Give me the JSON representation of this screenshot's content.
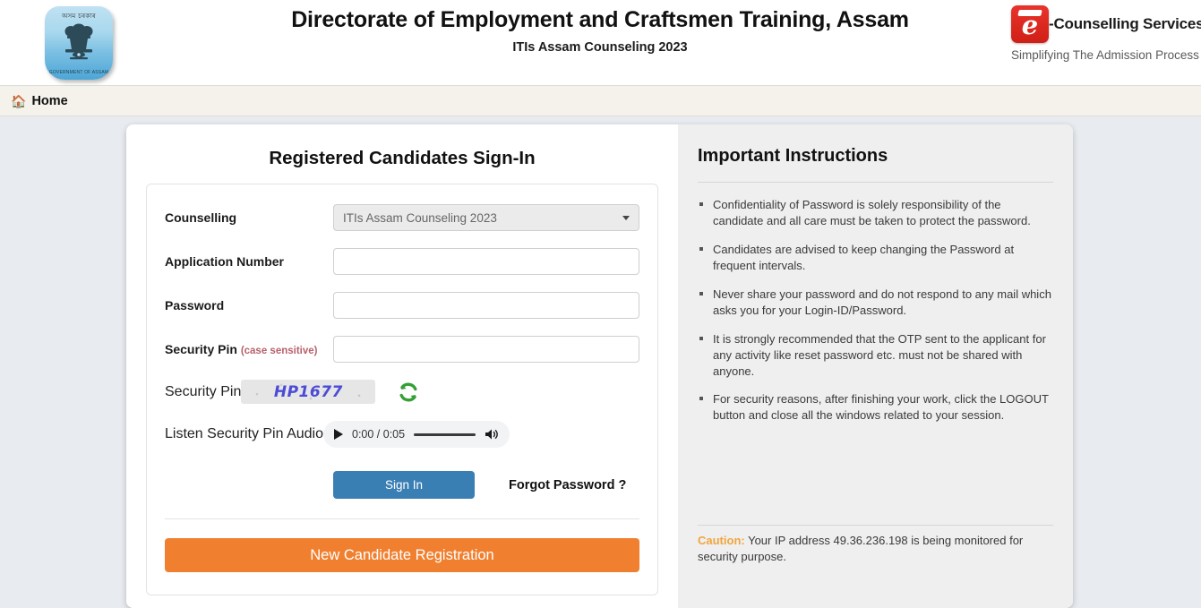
{
  "header": {
    "logo_left": {
      "top_script": "অসম চৰকাৰ",
      "bottom_script": "GOVERNMENT OF ASSAM"
    },
    "title": "Directorate of Employment and Craftsmen Training, Assam",
    "subtitle": "ITIs Assam Counseling 2023",
    "logo_right": {
      "badge_letter": "e",
      "name": "-Counselling Services",
      "tagline": "Simplifying The Admission Process"
    }
  },
  "navbar": {
    "home_label": "Home",
    "home_icon": "home-icon"
  },
  "signin": {
    "title": "Registered Candidates Sign-In",
    "fields": {
      "counselling_label": "Counselling",
      "counselling_value": "ITIs Assam Counseling 2023",
      "application_label": "Application Number",
      "application_value": "",
      "password_label": "Password",
      "password_value": "",
      "security_pin_label": "Security Pin",
      "security_pin_hint": "(case sensitive)",
      "security_pin_value": "",
      "captcha_label": "Security Pin",
      "captcha_text": "HP1677",
      "refresh_icon": "refresh-icon",
      "audio_label": "Listen Security Pin Audio",
      "audio_time": "0:00 / 0:05"
    },
    "signin_button": "Sign In",
    "forgot_password": "Forgot Password ?",
    "register_button": "New Candidate Registration"
  },
  "instructions": {
    "title": "Important Instructions",
    "items": [
      "Confidentiality of Password is solely responsibility of the candidate and all care must be taken to protect the password.",
      "Candidates are advised to keep changing the Password at frequent intervals.",
      "Never share your password and do not respond to any mail which asks you for your Login-ID/Password.",
      "It is strongly recommended that the OTP sent to the applicant for any activity like reset password etc. must not be shared with anyone.",
      "For security reasons, after finishing your work, click the LOGOUT button and close all the windows related to your session."
    ],
    "caution_label": "Caution:",
    "caution_text": " Your IP address 49.36.236.198 is being monitored for security purpose."
  },
  "colors": {
    "primary_blue": "#3a7fb4",
    "register_orange": "#f08030",
    "caution_orange": "#f0a53e",
    "captcha_blue": "#4b4bd8",
    "brand_red": "#d01f16"
  }
}
